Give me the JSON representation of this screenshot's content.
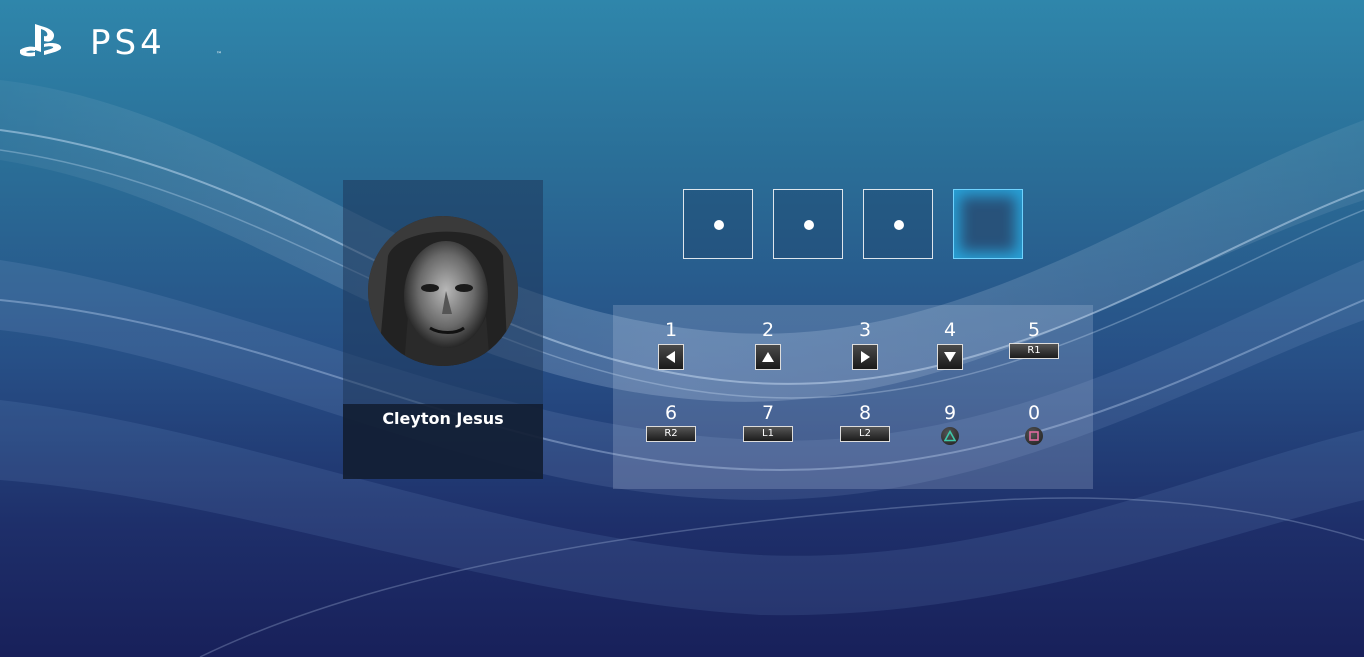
{
  "branding": {
    "logo_text": "PS4",
    "logo_icon": "playstation-logo-icon"
  },
  "user": {
    "name": "Cleyton Jesus",
    "avatar_icon": "user-avatar-photo"
  },
  "pin": {
    "length": 4,
    "entered": 3,
    "mask_char": "•"
  },
  "keypad": {
    "keys": [
      {
        "digit": "1",
        "button": "left-arrow-icon",
        "type": "arrow"
      },
      {
        "digit": "2",
        "button": "up-arrow-icon",
        "type": "arrow"
      },
      {
        "digit": "3",
        "button": "right-arrow-icon",
        "type": "arrow"
      },
      {
        "digit": "4",
        "button": "down-arrow-icon",
        "type": "arrow"
      },
      {
        "digit": "5",
        "button": "R1",
        "type": "shoulder"
      },
      {
        "digit": "6",
        "button": "R2",
        "type": "shoulder"
      },
      {
        "digit": "7",
        "button": "L1",
        "type": "shoulder"
      },
      {
        "digit": "8",
        "button": "L2",
        "type": "shoulder"
      },
      {
        "digit": "9",
        "button": "triangle-icon",
        "type": "face"
      },
      {
        "digit": "0",
        "button": "square-icon",
        "type": "face"
      }
    ]
  },
  "colors": {
    "triangle": "#3ec7a8",
    "square": "#e06aa0",
    "active_glow": "#28aae1"
  }
}
